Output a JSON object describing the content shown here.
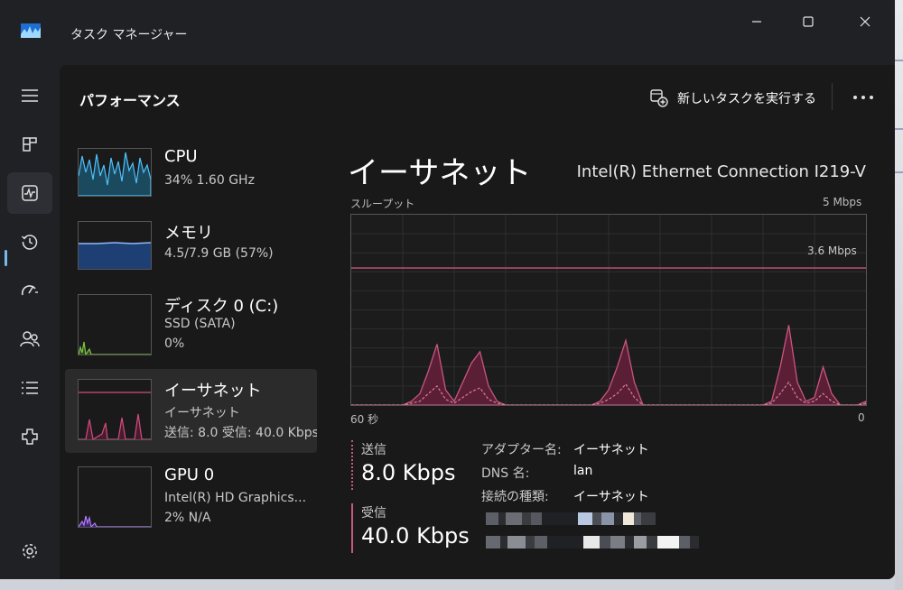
{
  "window": {
    "title": "タスク マネージャー",
    "icon": "task-manager-chart-icon",
    "accent": "#76b9ed"
  },
  "nav": [
    {
      "icon": "hamburger-menu-icon",
      "label": "Menu"
    },
    {
      "icon": "processes-icon",
      "label": "Processes"
    },
    {
      "icon": "performance-icon",
      "label": "Performance",
      "active": true
    },
    {
      "icon": "app-history-icon",
      "label": "App history"
    },
    {
      "icon": "startup-apps-icon",
      "label": "Startup apps"
    },
    {
      "icon": "users-icon",
      "label": "Users"
    },
    {
      "icon": "details-icon",
      "label": "Details"
    },
    {
      "icon": "services-icon",
      "label": "Services"
    },
    {
      "icon": "settings-icon",
      "label": "Settings"
    }
  ],
  "header": {
    "title": "パフォーマンス",
    "run_task": "新しいタスクを実行する",
    "more": "..."
  },
  "sidebar": {
    "items": [
      {
        "name": "CPU",
        "lines": [
          "34%  1.60 GHz"
        ],
        "color": "#4cc2ff",
        "usage": 0.34
      },
      {
        "name": "メモリ",
        "lines": [
          "4.5/7.9 GB (57%)"
        ],
        "color": "#8fb8ff",
        "usage": 0.57
      },
      {
        "name": "ディスク 0 (C:)",
        "lines": [
          "SSD (SATA)",
          "0%"
        ],
        "color": "#7ec24a",
        "usage": 0.0
      },
      {
        "name": "イーサネット",
        "lines": [
          "イーサネット",
          "送信: 8.0  受信: 40.0 Kbps"
        ],
        "color": "#d14d7e",
        "selected": true
      },
      {
        "name": "GPU 0",
        "lines": [
          "Intel(R) HD Graphics...",
          "2%  N/A"
        ],
        "color": "#b07cff",
        "usage": 0.02
      }
    ]
  },
  "detail": {
    "title": "イーサネット",
    "adapter": "Intel(R) Ethernet Connection I219-V",
    "graph": {
      "label": "スループット",
      "max_label": "5 Mbps",
      "ref_label": "3.6 Mbps",
      "time_label": "60 秒",
      "zero_label": "0",
      "line_color": "#c8567f",
      "fill_color": "#5a1f35"
    },
    "send": {
      "label": "送信",
      "value": "8.0 Kbps"
    },
    "receive": {
      "label": "受信",
      "value": "40.0 Kbps"
    },
    "properties": [
      {
        "label": "アダプター名:",
        "value": "イーサネット"
      },
      {
        "label": "DNS 名:",
        "value": "lan"
      },
      {
        "label": "接続の種類:",
        "value": "イーサネット"
      }
    ]
  },
  "chart_data": {
    "type": "area",
    "title": "スループット",
    "ylim": [
      0,
      5
    ],
    "ylabel": "Mbps",
    "reference_line": 3.6,
    "x": [
      0,
      1,
      2,
      3,
      4,
      5,
      6,
      7,
      8,
      9,
      10,
      11,
      12,
      13,
      14,
      15,
      16,
      17,
      18,
      19,
      20,
      21,
      22,
      23,
      24,
      25,
      26,
      27,
      28,
      29,
      30,
      31,
      32,
      33,
      34,
      35,
      36,
      37,
      38,
      39,
      40,
      41,
      42,
      43,
      44,
      45,
      46,
      47,
      48,
      49,
      50,
      51,
      52,
      53,
      54,
      55,
      56,
      57,
      58,
      59,
      60
    ],
    "series": [
      {
        "values": [
          0,
          0,
          0,
          0,
          0,
          0,
          0,
          0.1,
          0.3,
          0.9,
          1.6,
          0.4,
          0.1,
          0.6,
          1.1,
          1.4,
          0.5,
          0.1,
          0,
          0,
          0,
          0,
          0,
          0,
          0,
          0,
          0,
          0,
          0,
          0.1,
          0.4,
          1.0,
          1.7,
          0.6,
          0,
          0,
          0,
          0,
          0,
          0,
          0,
          0,
          0,
          0,
          0,
          0,
          0,
          0,
          0,
          0.1,
          1.0,
          2.1,
          0.6,
          0.1,
          0.2,
          1.0,
          0.3,
          0,
          0,
          0,
          0.1
        ]
      },
      {
        "values": [
          0,
          0,
          0,
          0,
          0,
          0,
          0,
          0.05,
          0.1,
          0.3,
          0.5,
          0.15,
          0.05,
          0.2,
          0.35,
          0.45,
          0.15,
          0.05,
          0,
          0,
          0,
          0,
          0,
          0,
          0,
          0,
          0,
          0,
          0,
          0.05,
          0.15,
          0.3,
          0.55,
          0.2,
          0,
          0,
          0,
          0,
          0,
          0,
          0,
          0,
          0,
          0,
          0,
          0,
          0,
          0,
          0,
          0.05,
          0.3,
          0.6,
          0.2,
          0.05,
          0.1,
          0.3,
          0.1,
          0,
          0,
          0,
          0.05
        ]
      }
    ]
  }
}
